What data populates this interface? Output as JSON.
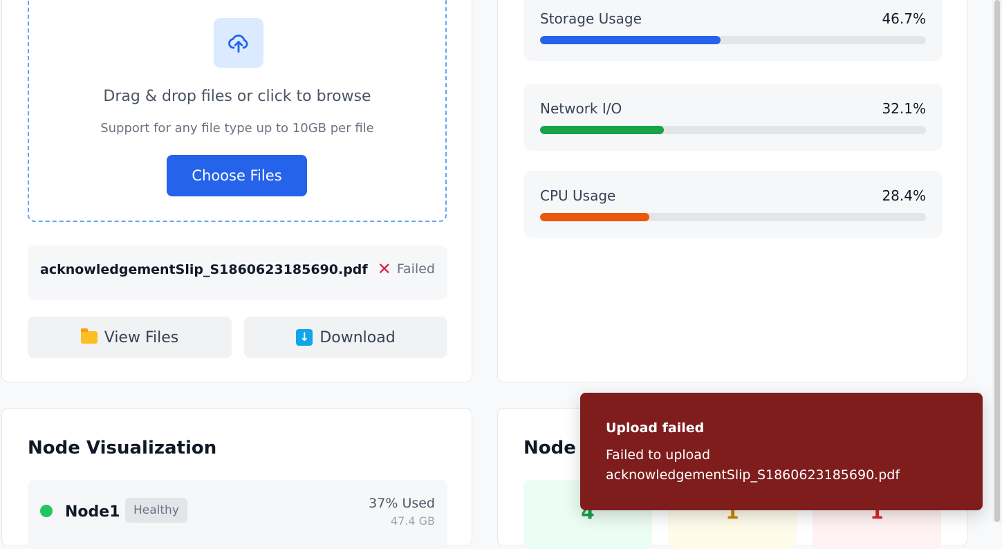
{
  "upload": {
    "dropzone_title": "Drag & drop files or click to browse",
    "dropzone_subtitle": "Support for any file type up to 10GB per file",
    "choose_label": "Choose Files",
    "file": {
      "name": "acknowledgementSlip_S1860623185690.pdf",
      "status": "Failed",
      "status_icon": "x-icon"
    },
    "view_files_label": "View Files",
    "download_label": "Download",
    "icons": {
      "upload": "cloud-upload-icon",
      "folder": "folder-icon",
      "download": "download-icon"
    }
  },
  "metrics": [
    {
      "label": "Storage Usage",
      "value": "46.7%",
      "percent": 46.7,
      "color": "#2563eb"
    },
    {
      "label": "Network I/O",
      "value": "32.1%",
      "percent": 32.1,
      "color": "#16a34a"
    },
    {
      "label": "CPU Usage",
      "value": "28.4%",
      "percent": 28.4,
      "color": "#ea580c"
    }
  ],
  "node_visualization": {
    "title": "Node Visualization",
    "nodes": [
      {
        "name": "Node1",
        "status": "Healthy",
        "used": "37% Used",
        "capacity": "47.4 GB",
        "status_color": "#22c55e"
      }
    ]
  },
  "node_health": {
    "title_visible": "Node H",
    "tiles": [
      {
        "count": "4",
        "bg": "#ecfdf3",
        "color": "#16a34a"
      },
      {
        "count": "1",
        "bg": "#fefbea",
        "color": "#ca8a04"
      },
      {
        "count": "1",
        "bg": "#fef2f2",
        "color": "#dc2626"
      }
    ]
  },
  "toast": {
    "title": "Upload failed",
    "message": "Failed to upload acknowledgementSlip_S1860623185690.pdf",
    "bg": "#7f1d1d"
  }
}
